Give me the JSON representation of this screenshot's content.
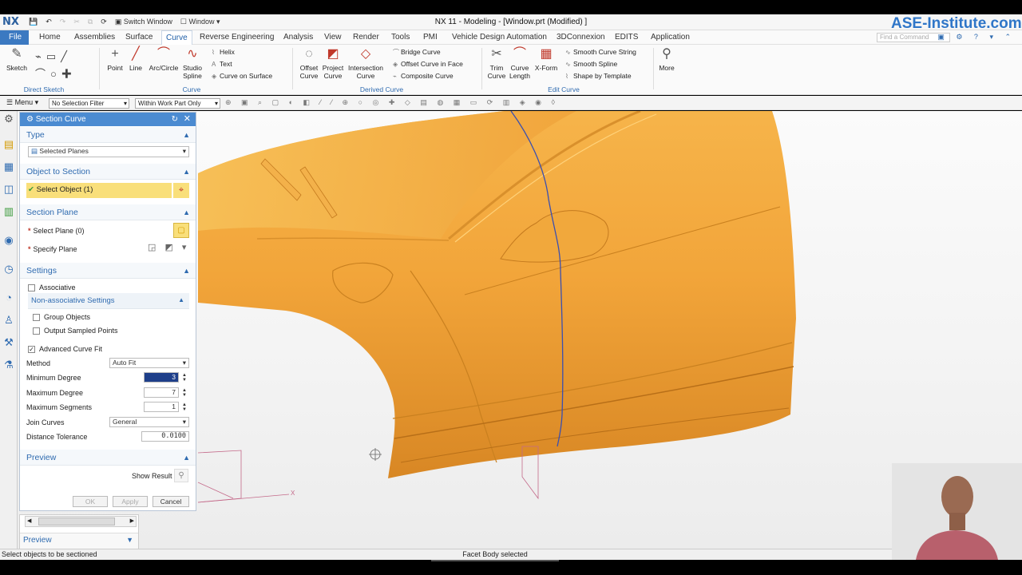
{
  "quick_access": {
    "switch_window": "Switch Window",
    "window_menu": "Window"
  },
  "window_title": "NX 11 - Modeling - [Window.prt (Modified) ]",
  "app_logo": "NX",
  "watermark": "ASE-Institute.com",
  "tabs": [
    "File",
    "Home",
    "Assemblies",
    "Surface",
    "Curve",
    "Reverse Engineering",
    "Analysis",
    "View",
    "Render",
    "Tools",
    "PMI",
    "Vehicle Design Automation",
    "3DConnexion",
    "EDITS",
    "Application"
  ],
  "active_tab": "Curve",
  "find_command_placeholder": "Find a Command",
  "ribbon": {
    "direct_sketch": {
      "sketch": "Sketch",
      "group_label": "Direct Sketch"
    },
    "curve": {
      "point": "Point",
      "line": "Line",
      "arc": "Arc/Circle",
      "studio_spline": "Studio Spline",
      "helix": "Helix",
      "text": "Text",
      "curve_on_surface": "Curve on Surface",
      "group_label": "Curve"
    },
    "derived_curve": {
      "offset_curve": "Offset Curve",
      "project_curve": "Project Curve",
      "intersection_curve": "Intersection Curve",
      "bridge_curve": "Bridge Curve",
      "offset_curve_in_face": "Offset Curve in Face",
      "composite_curve": "Composite Curve",
      "group_label": "Derived Curve"
    },
    "edit_curve": {
      "trim_curve": "Trim Curve",
      "curve_length": "Curve Length",
      "xform": "X-Form",
      "smooth_curve_string": "Smooth Curve String",
      "smooth_spline": "Smooth Spline",
      "shape_by_template": "Shape by Template",
      "group_label": "Edit Curve"
    },
    "more": "More"
  },
  "selection_bar": {
    "menu": "Menu",
    "filter": "No Selection Filter",
    "scope": "Within Work Part Only"
  },
  "dialog": {
    "title": "Section Curve",
    "type_header": "Type",
    "type_value": "Selected Planes",
    "object_header": "Object to Section",
    "select_object": "Select Object (1)",
    "plane_header": "Section Plane",
    "select_plane": "Select Plane (0)",
    "specify_plane": "Specify Plane",
    "settings_header": "Settings",
    "associative": "Associative",
    "non_assoc_header": "Non-associative Settings",
    "group_objects": "Group Objects",
    "output_sampled_points": "Output Sampled Points",
    "advanced_curve_fit": "Advanced Curve Fit",
    "method_label": "Method",
    "method_value": "Auto Fit",
    "min_degree_label": "Minimum Degree",
    "min_degree_value": "3",
    "max_degree_label": "Maximum Degree",
    "max_degree_value": "7",
    "max_segments_label": "Maximum Segments",
    "max_segments_value": "1",
    "join_curves_label": "Join Curves",
    "join_curves_value": "General",
    "distance_tolerance_label": "Distance Tolerance",
    "distance_tolerance_value": "0.0100",
    "preview_header": "Preview",
    "show_result": "Show Result",
    "ok": "OK",
    "apply": "Apply",
    "cancel": "Cancel"
  },
  "lower_preview": "Preview",
  "axis_x": "X",
  "status_left": "Select objects to be sectioned",
  "status_center": "Facet Body selected",
  "colors": {
    "accent": "#3b79c1",
    "dialog_header": "#4b8bd1",
    "car_body": "#f0a53a",
    "section_curve": "#3a4fb0"
  }
}
